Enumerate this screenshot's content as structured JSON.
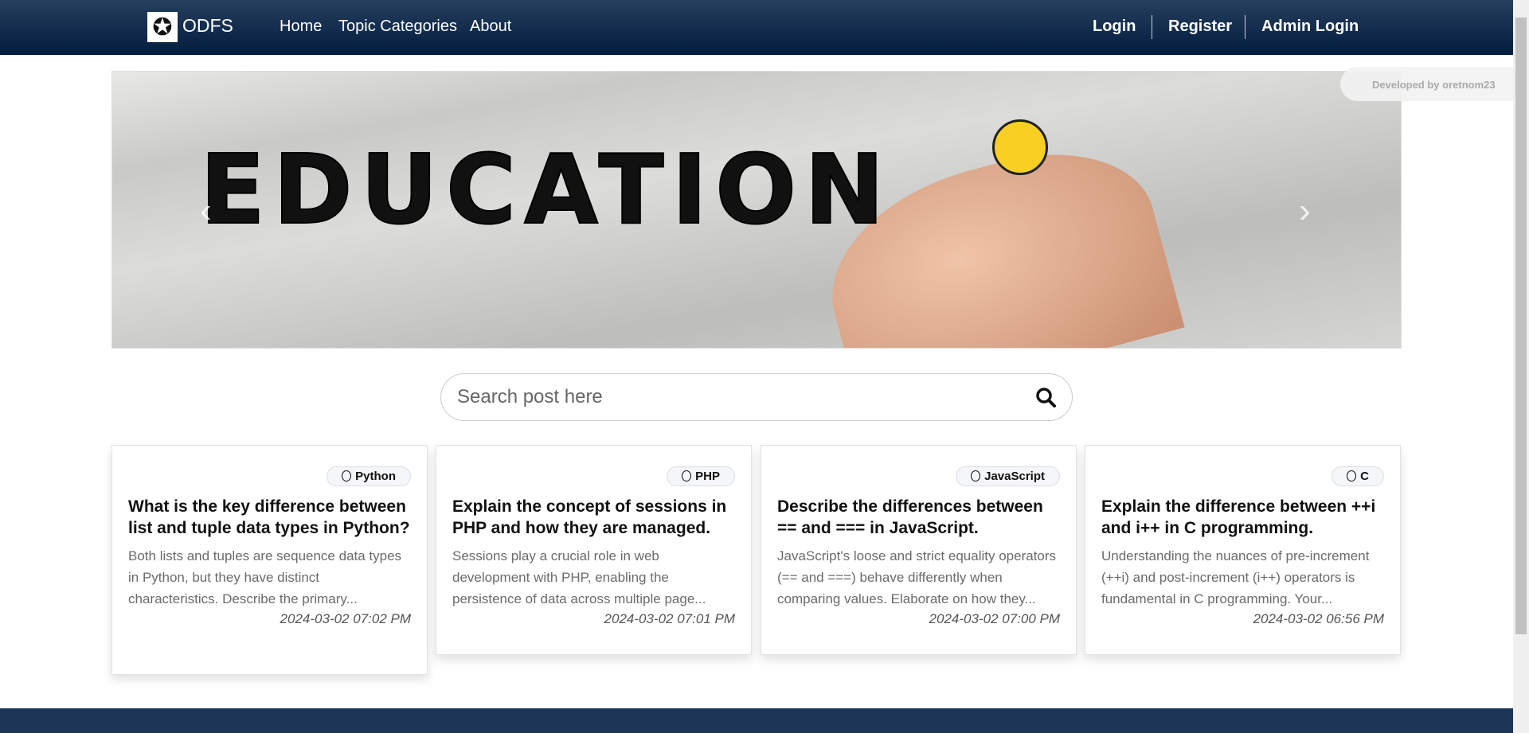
{
  "nav": {
    "brand": "ODFS",
    "links": [
      "Home",
      "Topic Categories",
      "About"
    ],
    "right": [
      "Login",
      "Register",
      "Admin Login"
    ]
  },
  "banner": {
    "word": "EDUCATION"
  },
  "developer_badge": "Developed by oretnom23",
  "search": {
    "placeholder": "Search post here",
    "value": ""
  },
  "posts": [
    {
      "category": "Python",
      "title": "What is the key difference between list and tuple data types in Python?",
      "excerpt": "Both lists and tuples are sequence data types in Python, but they have distinct characteristics. Describe the primary...",
      "date": "2024-03-02 07:02 PM"
    },
    {
      "category": "PHP",
      "title": "Explain the concept of sessions in PHP and how they are managed.",
      "excerpt": "Sessions play a crucial role in web development with PHP, enabling the persistence of data across multiple page...",
      "date": "2024-03-02 07:01 PM"
    },
    {
      "category": "JavaScript",
      "title": "Describe the differences between == and === in JavaScript.",
      "excerpt": "JavaScript's loose and strict equality operators (== and ===) behave differently when comparing values. Elaborate on how they...",
      "date": "2024-03-02 07:00 PM"
    },
    {
      "category": "C",
      "title": "Explain the difference between ++i and i++ in C programming.",
      "excerpt": "Understanding the nuances of pre-increment (++i) and post-increment (i++) operators is fundamental in C programming. Your...",
      "date": "2024-03-02 06:56 PM"
    }
  ]
}
